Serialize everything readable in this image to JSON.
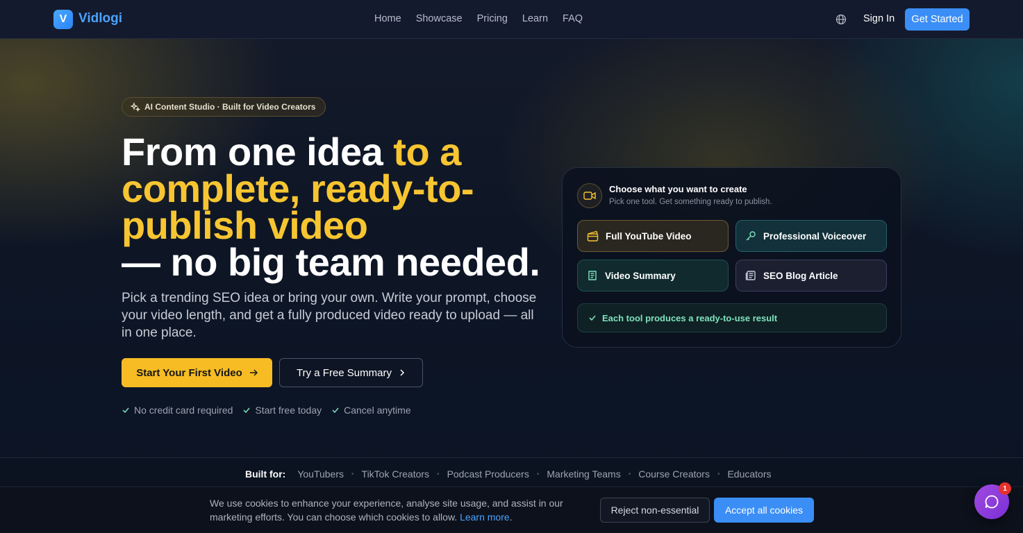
{
  "nav": {
    "logo_letter": "V",
    "brand": "Vidlogi",
    "links": [
      "Home",
      "Showcase",
      "Pricing",
      "Learn",
      "FAQ"
    ],
    "sign_in": "Sign In",
    "get_started": "Get Started"
  },
  "hero": {
    "badge": "AI Content Studio · Built for Video Creators",
    "headline_white_1": "From one idea ",
    "headline_yellow": "to a complete, ready-to-publish video",
    "headline_white_2": "— no big team needed.",
    "subtext": "Pick a trending SEO idea or bring your own. Write your prompt, choose your video length, and get a fully produced video ready to upload — all in one place.",
    "primary_cta": "Start Your First Video",
    "secondary_cta": "Try a Free Summary",
    "checks": [
      "No credit card required",
      "Start free today",
      "Cancel anytime"
    ]
  },
  "card": {
    "title": "Choose what you want to create",
    "subtitle": "Pick one tool. Get something ready to publish.",
    "tools": [
      "Full YouTube Video",
      "Professional Voiceover",
      "Video Summary",
      "SEO Blog Article"
    ],
    "result": "Each tool produces a ready-to-use result"
  },
  "built_for": {
    "label": "Built for:",
    "items": [
      "YouTubers",
      "TikTok Creators",
      "Podcast Producers",
      "Marketing Teams",
      "Course Creators",
      "Educators"
    ]
  },
  "cookie": {
    "text": "We use cookies to enhance your experience, analyse site usage, and assist in our marketing efforts. You can choose which cookies to allow.",
    "link": "Learn more",
    "period": ".",
    "reject": "Reject non-essential",
    "accept": "Accept all cookies"
  },
  "chat": {
    "badge_count": "1"
  },
  "colors": {
    "accent_blue": "#3b8ef5",
    "accent_yellow": "#f7c531",
    "accent_green": "#7ee2bd"
  }
}
